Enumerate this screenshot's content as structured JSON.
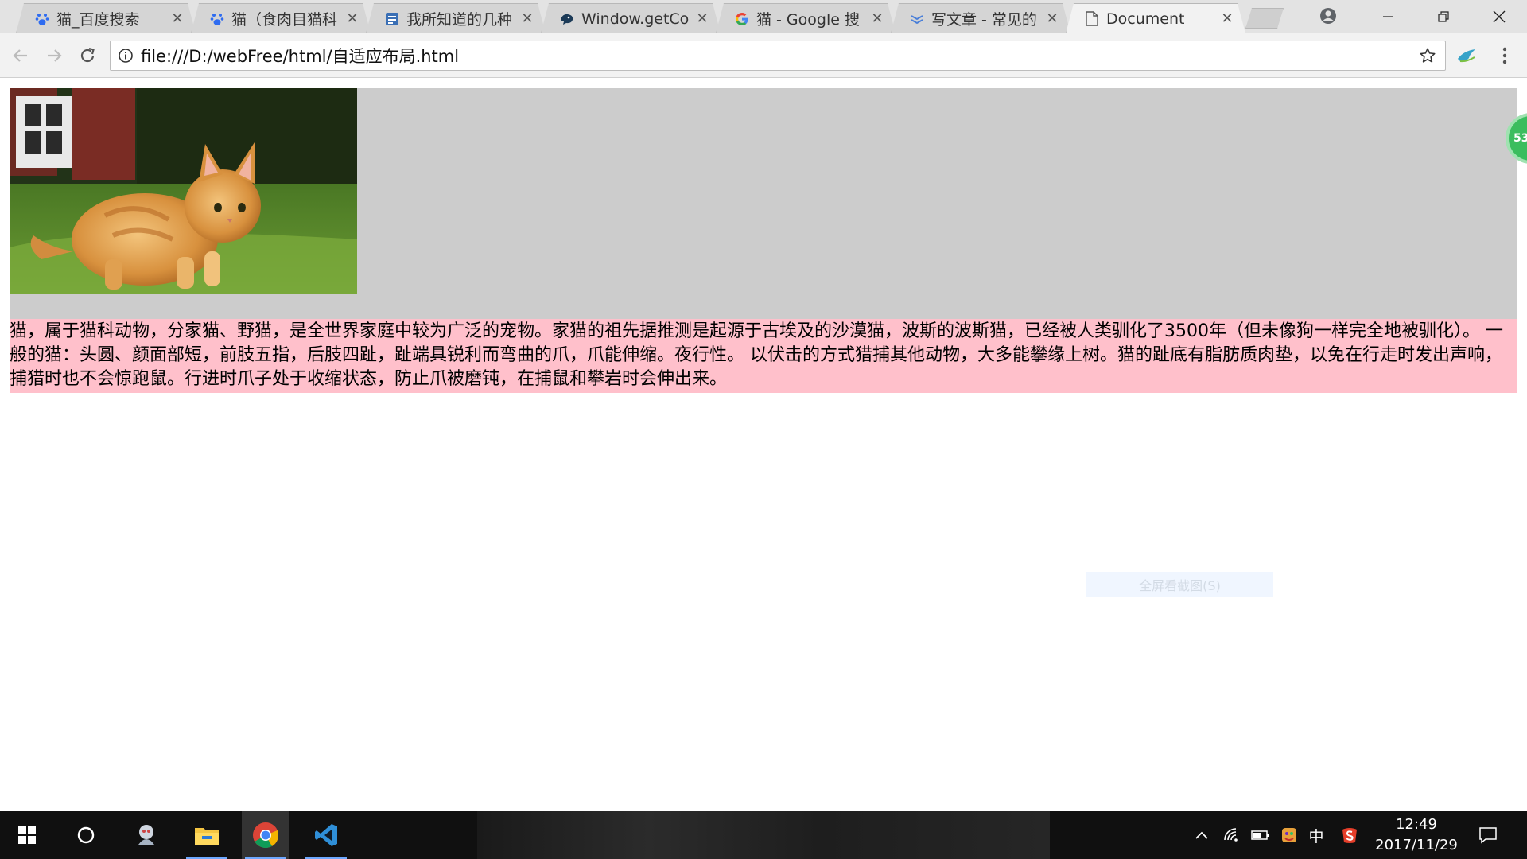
{
  "browser": {
    "tabs": [
      {
        "title": "猫_百度搜索",
        "icon": "baidu-paw-icon"
      },
      {
        "title": "猫（食肉目猫科",
        "icon": "baidu-paw-icon"
      },
      {
        "title": "我所知道的几种",
        "icon": "blog-icon"
      },
      {
        "title": "Window.getCo",
        "icon": "mdn-icon"
      },
      {
        "title": "猫 - Google 搜",
        "icon": "google-icon"
      },
      {
        "title": "写文章 - 常见的",
        "icon": "csdn-icon"
      },
      {
        "title": "Document",
        "icon": "document-icon",
        "active": true
      }
    ],
    "url": "file:///D:/webFree/html/自适应布局.html"
  },
  "page": {
    "paragraph": "猫，属于猫科动物，分家猫、野猫，是全世界家庭中较为广泛的宠物。家猫的祖先据推测是起源于古埃及的沙漠猫，波斯的波斯猫，已经被人类驯化了3500年（但未像狗一样完全地被驯化）。 一般的猫：头圆、颜面部短，前肢五指，后肢四趾，趾端具锐利而弯曲的爪，爪能伸缩。夜行性。 以伏击的方式猎捕其他动物，大多能攀缘上树。猫的趾底有脂肪质肉垫，以免在行走时发出声响，捕猎时也不会惊跑鼠。行进时爪子处于收缩状态，防止爪被磨钝，在捕鼠和攀岩时会伸出来。",
    "floating_badge": "53",
    "screenshot_button": "全屏看截图(S)",
    "colors": {
      "banner": "#cccccc",
      "paragraph_bg": "#ffc0cb"
    }
  },
  "taskbar": {
    "input_method": "中",
    "time": "12:49",
    "date": "2017/11/29"
  }
}
